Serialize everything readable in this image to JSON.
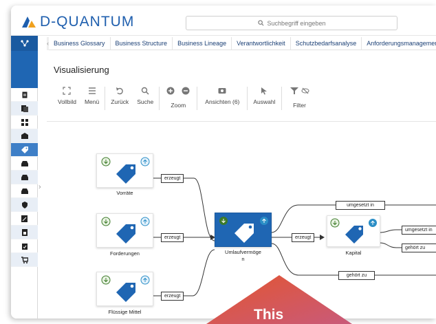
{
  "app": {
    "logo_text": "D-QUANTUM",
    "search_placeholder": "Suchbegriff eingeben"
  },
  "tabs": [
    {
      "label": "Business Glossary"
    },
    {
      "label": "Business Structure"
    },
    {
      "label": "Business Lineage"
    },
    {
      "label": "Verantwortlichkeit"
    },
    {
      "label": "Schutzbedarfsanalyse"
    },
    {
      "label": "Anforderungsmanagemen"
    }
  ],
  "page": {
    "title": "Visualisierung"
  },
  "toolbar": {
    "vollbild": "Vollbild",
    "menu": "Menü",
    "zurueck": "Zurück",
    "suche": "Suche",
    "zoom": "Zoom",
    "ansichten": "Ansichten (6)",
    "auswahl": "Auswahl",
    "filter": "Filter"
  },
  "nodes": {
    "vorraete": "Vorräte",
    "forderungen": "Forderungen",
    "fluessige": "Flüssige Mittel",
    "umlauf_line1": "Umlaufvermöge",
    "umlauf_line2": "n",
    "kapital": "Kapital"
  },
  "edges": {
    "e1": "erzeugt",
    "e2": "erzeugt",
    "e3": "erzeugt",
    "e4": "erzeugt",
    "e5": "umgesetzt in",
    "e6": "gehört zu",
    "e7": "umgesetzt in",
    "e8": "gehört zu"
  },
  "banner": {
    "text": "This"
  },
  "colors": {
    "brand": "#1f66b3",
    "banner": "#d8613a"
  }
}
